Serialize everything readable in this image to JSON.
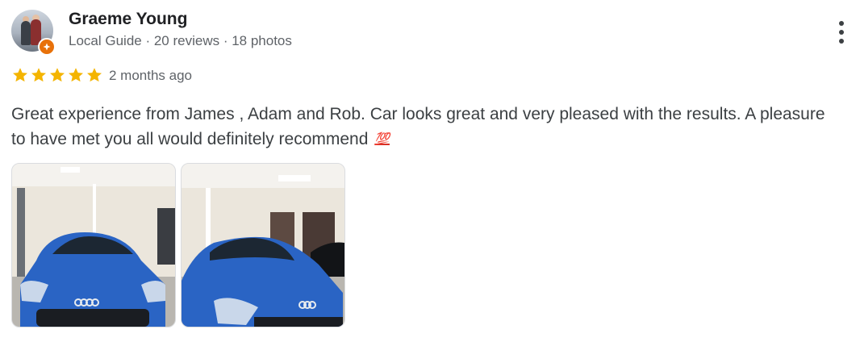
{
  "reviewer": {
    "name": "Graeme Young",
    "meta": "Local Guide · 20 reviews · 18 photos",
    "avatar_icon": "reviewer-photo",
    "badge_icon": "local-guide-star-icon"
  },
  "review": {
    "rating": 5,
    "rating_max": 5,
    "date": "2 months ago",
    "text": "Great experience from James , Adam and Rob. Car looks great and very pleased with the results. A pleasure to have met you all would definitely recommend",
    "emoji": "💯",
    "photos": [
      {
        "label": "Blue Audi TTS front view in showroom"
      },
      {
        "label": "Blue Audi TT angled view in showroom"
      }
    ]
  },
  "menu_icon": "more-vertical-icon",
  "colors": {
    "star": "#f4b400",
    "badge": "#e8710a",
    "car_blue": "#2a64c4",
    "text_secondary": "#5f6368"
  }
}
